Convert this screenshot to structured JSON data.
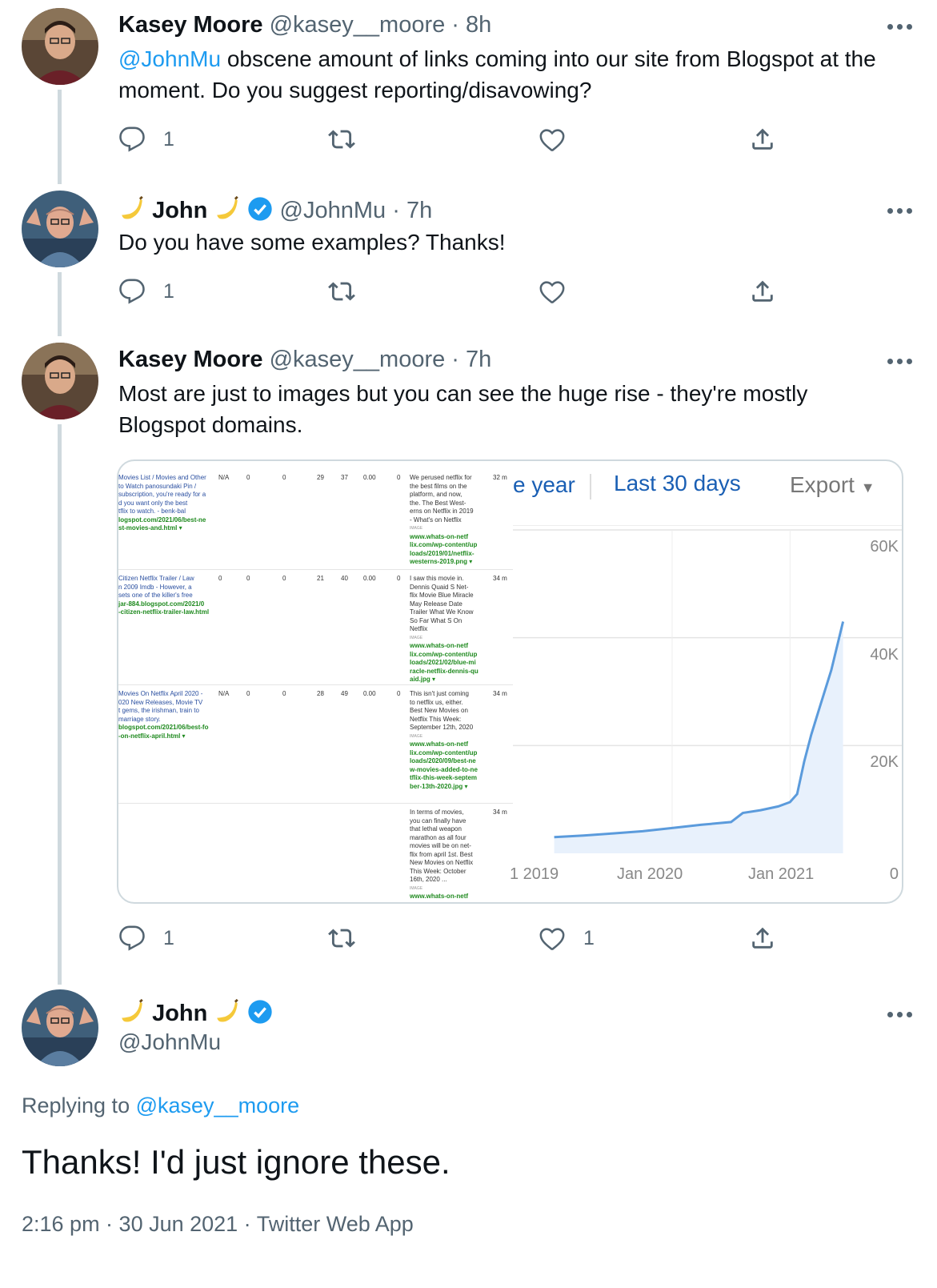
{
  "tweets": [
    {
      "name": "Kasey Moore",
      "handle": "@kasey__moore",
      "time": "8h",
      "mention": "@JohnMu",
      "text": " obscene amount of links coming into our site from Blogspot at the moment. Do you suggest reporting/disavowing?",
      "reply_count": "1",
      "retweet_count": "",
      "like_count": ""
    },
    {
      "name": "John",
      "handle": "@JohnMu",
      "time": "7h",
      "text": "Do you have some examples? Thanks!",
      "reply_count": "1",
      "retweet_count": "",
      "like_count": ""
    },
    {
      "name": "Kasey Moore",
      "handle": "@kasey__moore",
      "time": "7h",
      "text": "Most are just to images but you can see the huge rise - they're mostly Blogspot domains.",
      "reply_count": "1",
      "retweet_count": "",
      "like_count": "1"
    }
  ],
  "media": {
    "table_rows": [
      {
        "source_lines": [
          "Movies List / Movies and Other",
          "to Watch panosundaki Pin /",
          "subscription, you're ready for a",
          "d you want only the best",
          "tflix to watch. - benk-bal"
        ],
        "source_url": [
          "logspot.com/2021/06/best-ne",
          "st-movies-and.html ▾"
        ],
        "cols": [
          "N/A",
          "0",
          "0",
          "29",
          "37",
          "0.00",
          "0"
        ],
        "target_lines": [
          "We perused netflix for",
          "the best films on the",
          "platform, and now,",
          "the. The Best West-",
          "erns on Netflix in 2019",
          "- What's on Netflix"
        ],
        "target_tag": "IMAGE",
        "target_url": [
          "www.whats-on-netf",
          "lix.com/wp-content/up",
          "loads/2019/01/netflix-",
          "westerns-2019.png ▾"
        ],
        "age": "32 m"
      },
      {
        "source_lines": [
          "Citizen Netflix Trailer / Law",
          "n 2009 Imdb - However, a",
          "sets one of the killer's free"
        ],
        "source_url": [
          "jar-884.blogspot.com/2021/0",
          "-citizen-netflix-trailer-law.html"
        ],
        "cols": [
          "0",
          "0",
          "0",
          "21",
          "40",
          "0.00",
          "0"
        ],
        "target_lines": [
          "I saw this movie in.",
          "Dennis Quaid S Net-",
          "flix Movie Blue Miracle",
          "May Release Date",
          "Trailer What We Know",
          "So Far What S On",
          "Netflix"
        ],
        "target_tag": "IMAGE",
        "target_url": [
          "www.whats-on-netf",
          "lix.com/wp-content/up",
          "loads/2021/02/blue-mi",
          "racle-netflix-dennis-qu",
          "aid.jpg ▾"
        ],
        "age": "34 m"
      },
      {
        "source_lines": [
          "Movies On Netflix April 2020 -",
          "020 New Releases, Movie TV",
          "t gems, the irishman, train to",
          "marriage story."
        ],
        "source_url": [
          "blogspot.com/2021/06/best-fo",
          "-on-netflix-april.html ▾"
        ],
        "cols": [
          "N/A",
          "0",
          "0",
          "28",
          "49",
          "0.00",
          "0"
        ],
        "target_lines": [
          "This isn't just coming",
          "to netflix us, either.",
          "Best New Movies on",
          "Netflix This Week:",
          "September 12th, 2020"
        ],
        "target_tag": "IMAGE",
        "target_url": [
          "www.whats-on-netf",
          "lix.com/wp-content/up",
          "loads/2020/09/best-ne",
          "w-movies-added-to-ne",
          "tflix-this-week-septem",
          "ber-13th-2020.jpg ▾"
        ],
        "age": "34 m"
      },
      {
        "source_lines": [],
        "source_url": [],
        "cols": [
          "",
          "",
          "",
          "",
          "",
          "",
          ""
        ],
        "target_lines": [
          "In terms of movies,",
          "you can finally have",
          "that lethal weapon",
          "marathon as all four",
          "movies will be on net-",
          "flix from april 1st. Best",
          "New Movies on Netflix",
          "This Week: October",
          "16th, 2020 ..."
        ],
        "target_tag": "IMAGE",
        "target_url": [
          "www.whats-on-netf"
        ],
        "age": "34 m"
      }
    ],
    "tabs": {
      "year": "e year",
      "last30": "Last 30 days",
      "export": "Export"
    },
    "chart_data": {
      "type": "area",
      "title": "",
      "xlabel": "",
      "ylabel": "",
      "x_ticks": [
        "1 2019",
        "Jan 2020",
        "Jan 2021"
      ],
      "y_ticks": [
        "60K",
        "40K",
        "20K",
        "0"
      ],
      "ylim": [
        0,
        60000
      ],
      "series": [
        {
          "x": [
            2019.0,
            2019.25,
            2019.5,
            2019.75,
            2020.0,
            2020.25,
            2020.5,
            2020.6,
            2020.75,
            2020.9,
            2021.0,
            2021.06,
            2021.12,
            2021.18,
            2021.25,
            2021.35,
            2021.45
          ],
          "y": [
            3000,
            3300,
            3700,
            4100,
            4700,
            5300,
            5800,
            7500,
            8000,
            8700,
            9500,
            11000,
            17000,
            22000,
            27000,
            34000,
            43000
          ]
        }
      ],
      "grid": true
    }
  },
  "final_tweet": {
    "name": "John",
    "handle": "@JohnMu",
    "replying_label": "Replying to",
    "replying_to": "@kasey__moore",
    "text": "Thanks! I'd just ignore these.",
    "timestamp": "2:16 pm · 30 Jun 2021 · Twitter Web App"
  }
}
